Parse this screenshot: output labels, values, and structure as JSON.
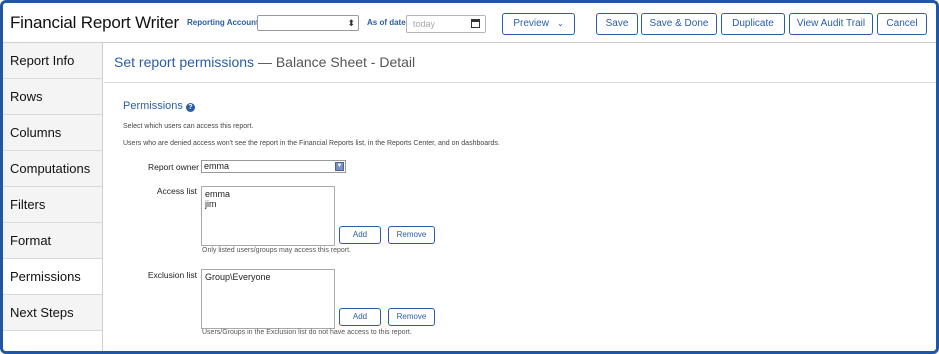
{
  "app": {
    "title": "Financial Report Writer"
  },
  "toolbar": {
    "reporting_accounts_label": "Reporting Accounts",
    "reporting_accounts_value": "",
    "as_of_date_label": "As of date",
    "as_of_date_placeholder": "today",
    "preview_label": "Preview",
    "save_label": "Save",
    "save_done_label": "Save & Done",
    "duplicate_label": "Duplicate",
    "audit_trail_label": "View Audit Trail",
    "cancel_label": "Cancel"
  },
  "sidebar": {
    "items": [
      {
        "label": "Report Info"
      },
      {
        "label": "Rows"
      },
      {
        "label": "Columns"
      },
      {
        "label": "Computations"
      },
      {
        "label": "Filters"
      },
      {
        "label": "Format"
      },
      {
        "label": "Permissions"
      },
      {
        "label": "Next Steps"
      }
    ],
    "active": "Permissions"
  },
  "header": {
    "title": "Set report permissions",
    "separator": "—",
    "subtitle": "Balance Sheet - Detail"
  },
  "permissions": {
    "section_title": "Permissions",
    "desc1": "Select which users can access this report.",
    "desc2": "Users who are denied access won't see the report in the Financial Reports list, in the Reports Center, and on dashboards.",
    "owner_label": "Report owner",
    "owner_value": "emma",
    "access_label": "Access list",
    "access_entries": [
      "emma",
      "jim"
    ],
    "access_hint": "Only listed users/groups may access this report.",
    "exclusion_label": "Exclusion list",
    "exclusion_entries": [
      "Group\\Everyone"
    ],
    "exclusion_hint": "Users/Groups in the Exclusion list do not have access to this report.",
    "add_label": "Add",
    "remove_label": "Remove"
  },
  "colors": {
    "accent": "#2a5da8",
    "frame": "#1f57a6",
    "sidebar_bg": "#f4f4f4"
  },
  "icons": {
    "calendar": "calendar-icon",
    "help": "help-icon",
    "dropdown": "chevron-down-icon"
  }
}
